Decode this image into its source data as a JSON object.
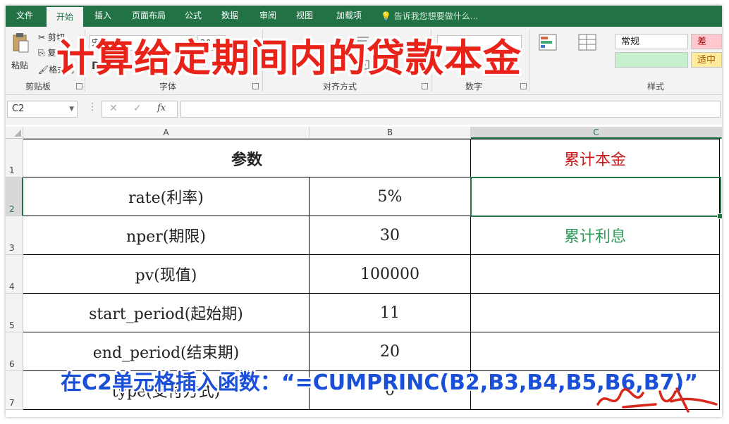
{
  "tabs": [
    "文件",
    "开始",
    "插入",
    "页面布局",
    "公式",
    "数据",
    "审阅",
    "视图",
    "加载项"
  ],
  "tell_me": "告诉我您想要做什么...",
  "ribbon": {
    "groups": [
      "剪贴板",
      "字体",
      "对齐方式",
      "数字",
      "样式"
    ],
    "paste_label": "粘贴",
    "cut_label": "剪切",
    "copy_label": "复制",
    "format_painter_label": "格式刷",
    "font_name": "宋体",
    "font_size": "20",
    "bold": "B",
    "italic": "I",
    "style_normal": "常规",
    "style_bad": "差",
    "style_neutral": "适中"
  },
  "title_overlay": "计算给定期间内的贷款本金",
  "formula_bar": {
    "name_box": "C2",
    "fx": "fx",
    "cancel": "✕",
    "enter": "✓",
    "value": ""
  },
  "columns": [
    "A",
    "B",
    "C"
  ],
  "rows": [
    "1",
    "2",
    "3",
    "4",
    "5",
    "6",
    "7"
  ],
  "sheet": {
    "header": "参数",
    "c1": "累计本金",
    "c3": "累计利息",
    "params": [
      {
        "label": "rate(利率)",
        "value": "5%"
      },
      {
        "label": "nper(期限)",
        "value": "30"
      },
      {
        "label": "pv(现值)",
        "value": "100000"
      },
      {
        "label": "start_period(起始期)",
        "value": "11"
      },
      {
        "label": "end_period(结束期)",
        "value": "20"
      },
      {
        "label": "type(支付方式)",
        "value": "0"
      }
    ]
  },
  "formula_overlay": "在C2单元格插入函数：“=CUMPRINC(B2,B3,B4,B5,B6,B7)”",
  "colors": {
    "excel_green": "#217346",
    "title_red": "#e8231a",
    "c1_red": "#c8191b",
    "c3_green": "#2f9a5a",
    "formula_blue": "#1a4fd8"
  }
}
